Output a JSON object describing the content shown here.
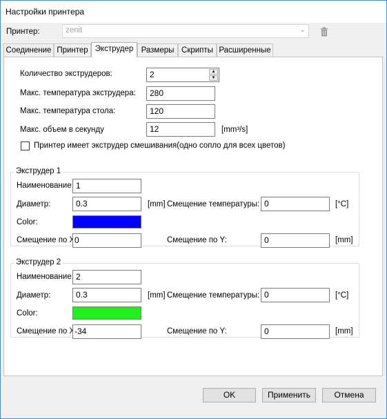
{
  "window": {
    "title": "Настройки принтера"
  },
  "printer": {
    "label": "Принтер:",
    "value": "zenit"
  },
  "tabs": [
    {
      "label": "Соединение"
    },
    {
      "label": "Принтер"
    },
    {
      "label": "Экструдер"
    },
    {
      "label": "Размеры"
    },
    {
      "label": "Скрипты"
    },
    {
      "label": "Расширенные"
    }
  ],
  "general": {
    "extruder_count_label": "Количество экструдеров:",
    "extruder_count": "2",
    "max_extruder_temp_label": "Макс. температура экструдера:",
    "max_extruder_temp": "280",
    "max_bed_temp_label": "Макс. температура стола:",
    "max_bed_temp": "120",
    "max_volume_label": "Макс. объем в секунду",
    "max_volume": "12",
    "max_volume_unit": "[mm³/s]",
    "mixing_label": "Принтер имеет экструдер смешивания(одно сопло для всех цветов)",
    "mixing_checked": false
  },
  "extruders": [
    {
      "title": "Экструдер 1",
      "name_label": "Наименование:",
      "name": "1",
      "diameter_label": "Диаметр:",
      "diameter": "0.3",
      "diameter_unit": "[mm]",
      "temp_offset_label": "Смещение температуры:",
      "temp_offset": "0",
      "temp_unit": "[°C]",
      "color_label": "Color:",
      "color": "#0000ff",
      "offset_x_label": "Смещение по X:",
      "offset_x": "0",
      "offset_y_label": "Смещение по Y:",
      "offset_y": "0",
      "offset_unit": "[mm]"
    },
    {
      "title": "Экструдер 2",
      "name_label": "Наименование:",
      "name": "2",
      "diameter_label": "Диаметр:",
      "diameter": "0.3",
      "diameter_unit": "[mm]",
      "temp_offset_label": "Смещение температуры:",
      "temp_offset": "0",
      "temp_unit": "[°C]",
      "color_label": "Color:",
      "color": "#20f020",
      "offset_x_label": "Смещение по X:",
      "offset_x": "-34",
      "offset_y_label": "Смещение по Y:",
      "offset_y": "0",
      "offset_unit": "[mm]"
    }
  ],
  "buttons": {
    "ok": "OK",
    "apply": "Применить",
    "cancel": "Отмена"
  }
}
